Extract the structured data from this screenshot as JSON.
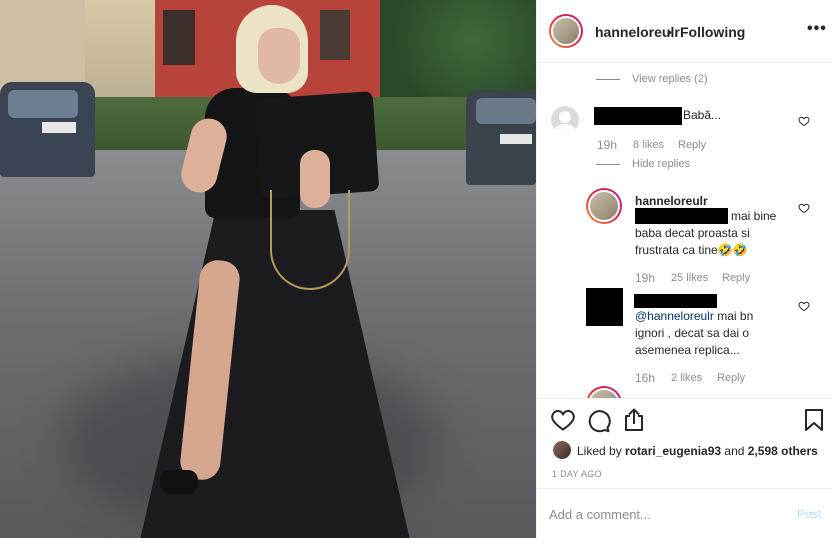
{
  "header": {
    "username": "hanneloreulr",
    "separator": "•",
    "follow_status": "Following",
    "more_icon": "more-horizontal-icon"
  },
  "comments": {
    "view_replies": "View replies (2)",
    "c1": {
      "text": "Babă...",
      "time": "19h",
      "likes": "8 likes",
      "reply": "Reply",
      "hide_replies": "Hide replies"
    },
    "r1": {
      "username": "hanneloreulr",
      "text": "mai bine baba decat proasta si frustrata ca tine🤣🤣",
      "time": "19h",
      "likes": "25 likes",
      "reply": "Reply"
    },
    "r2": {
      "mention": "@hanneloreulr",
      "text": " mai bn ignori , decat sa dai o asemenea replica...",
      "time": "16h",
      "likes": "2 likes",
      "reply": "Reply"
    }
  },
  "actions": {
    "liked_by_prefix": "Liked by ",
    "liked_by_user": "rotari_eugenia93",
    "liked_by_suffix": " and ",
    "liked_by_count": "2,598 others",
    "date": "1 DAY AGO"
  },
  "comment_box": {
    "placeholder": "Add a comment...",
    "post_label": "Post"
  },
  "colors": {
    "border": "#efefef",
    "muted": "#8e8e8e",
    "post_disabled": "#b2dffc",
    "link": "#00376b"
  }
}
